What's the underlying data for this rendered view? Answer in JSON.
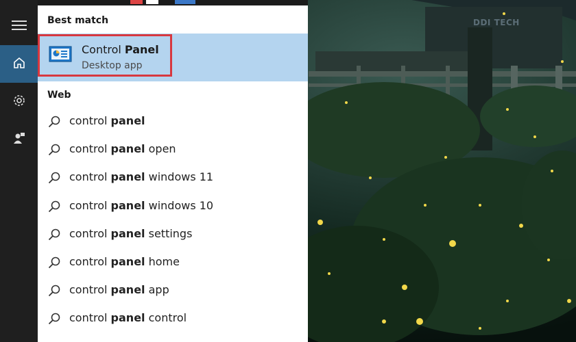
{
  "start_menu": {
    "rail": {
      "items": [
        {
          "icon": "hamburger-menu-icon"
        },
        {
          "icon": "home-icon"
        },
        {
          "icon": "gear-icon"
        },
        {
          "icon": "user-feedback-icon"
        }
      ]
    },
    "best_match": {
      "header": "Best match",
      "title_normal": "Control ",
      "title_bold": "Panel",
      "subtitle": "Desktop app",
      "icon": "control-panel-icon",
      "highlight_color": "#b4d4ef",
      "outline_color": "#d8383f"
    },
    "web": {
      "header": "Web",
      "suggestions": [
        {
          "prefix": "control ",
          "bold": "panel",
          "suffix": ""
        },
        {
          "prefix": "control ",
          "bold": "panel",
          "suffix": " open"
        },
        {
          "prefix": "control ",
          "bold": "panel",
          "suffix": " windows 11"
        },
        {
          "prefix": "control ",
          "bold": "panel",
          "suffix": " windows 10"
        },
        {
          "prefix": "control ",
          "bold": "panel",
          "suffix": " settings"
        },
        {
          "prefix": "control ",
          "bold": "panel",
          "suffix": " home"
        },
        {
          "prefix": "control ",
          "bold": "panel",
          "suffix": " app"
        },
        {
          "prefix": "control ",
          "bold": "panel",
          "suffix": " control"
        }
      ]
    }
  },
  "watermark": {
    "text": "DDI TECH"
  },
  "colors": {
    "rail_bg": "#1f1f1f",
    "rail_active": "#2b5f86",
    "panel_bg": "#ffffff"
  }
}
